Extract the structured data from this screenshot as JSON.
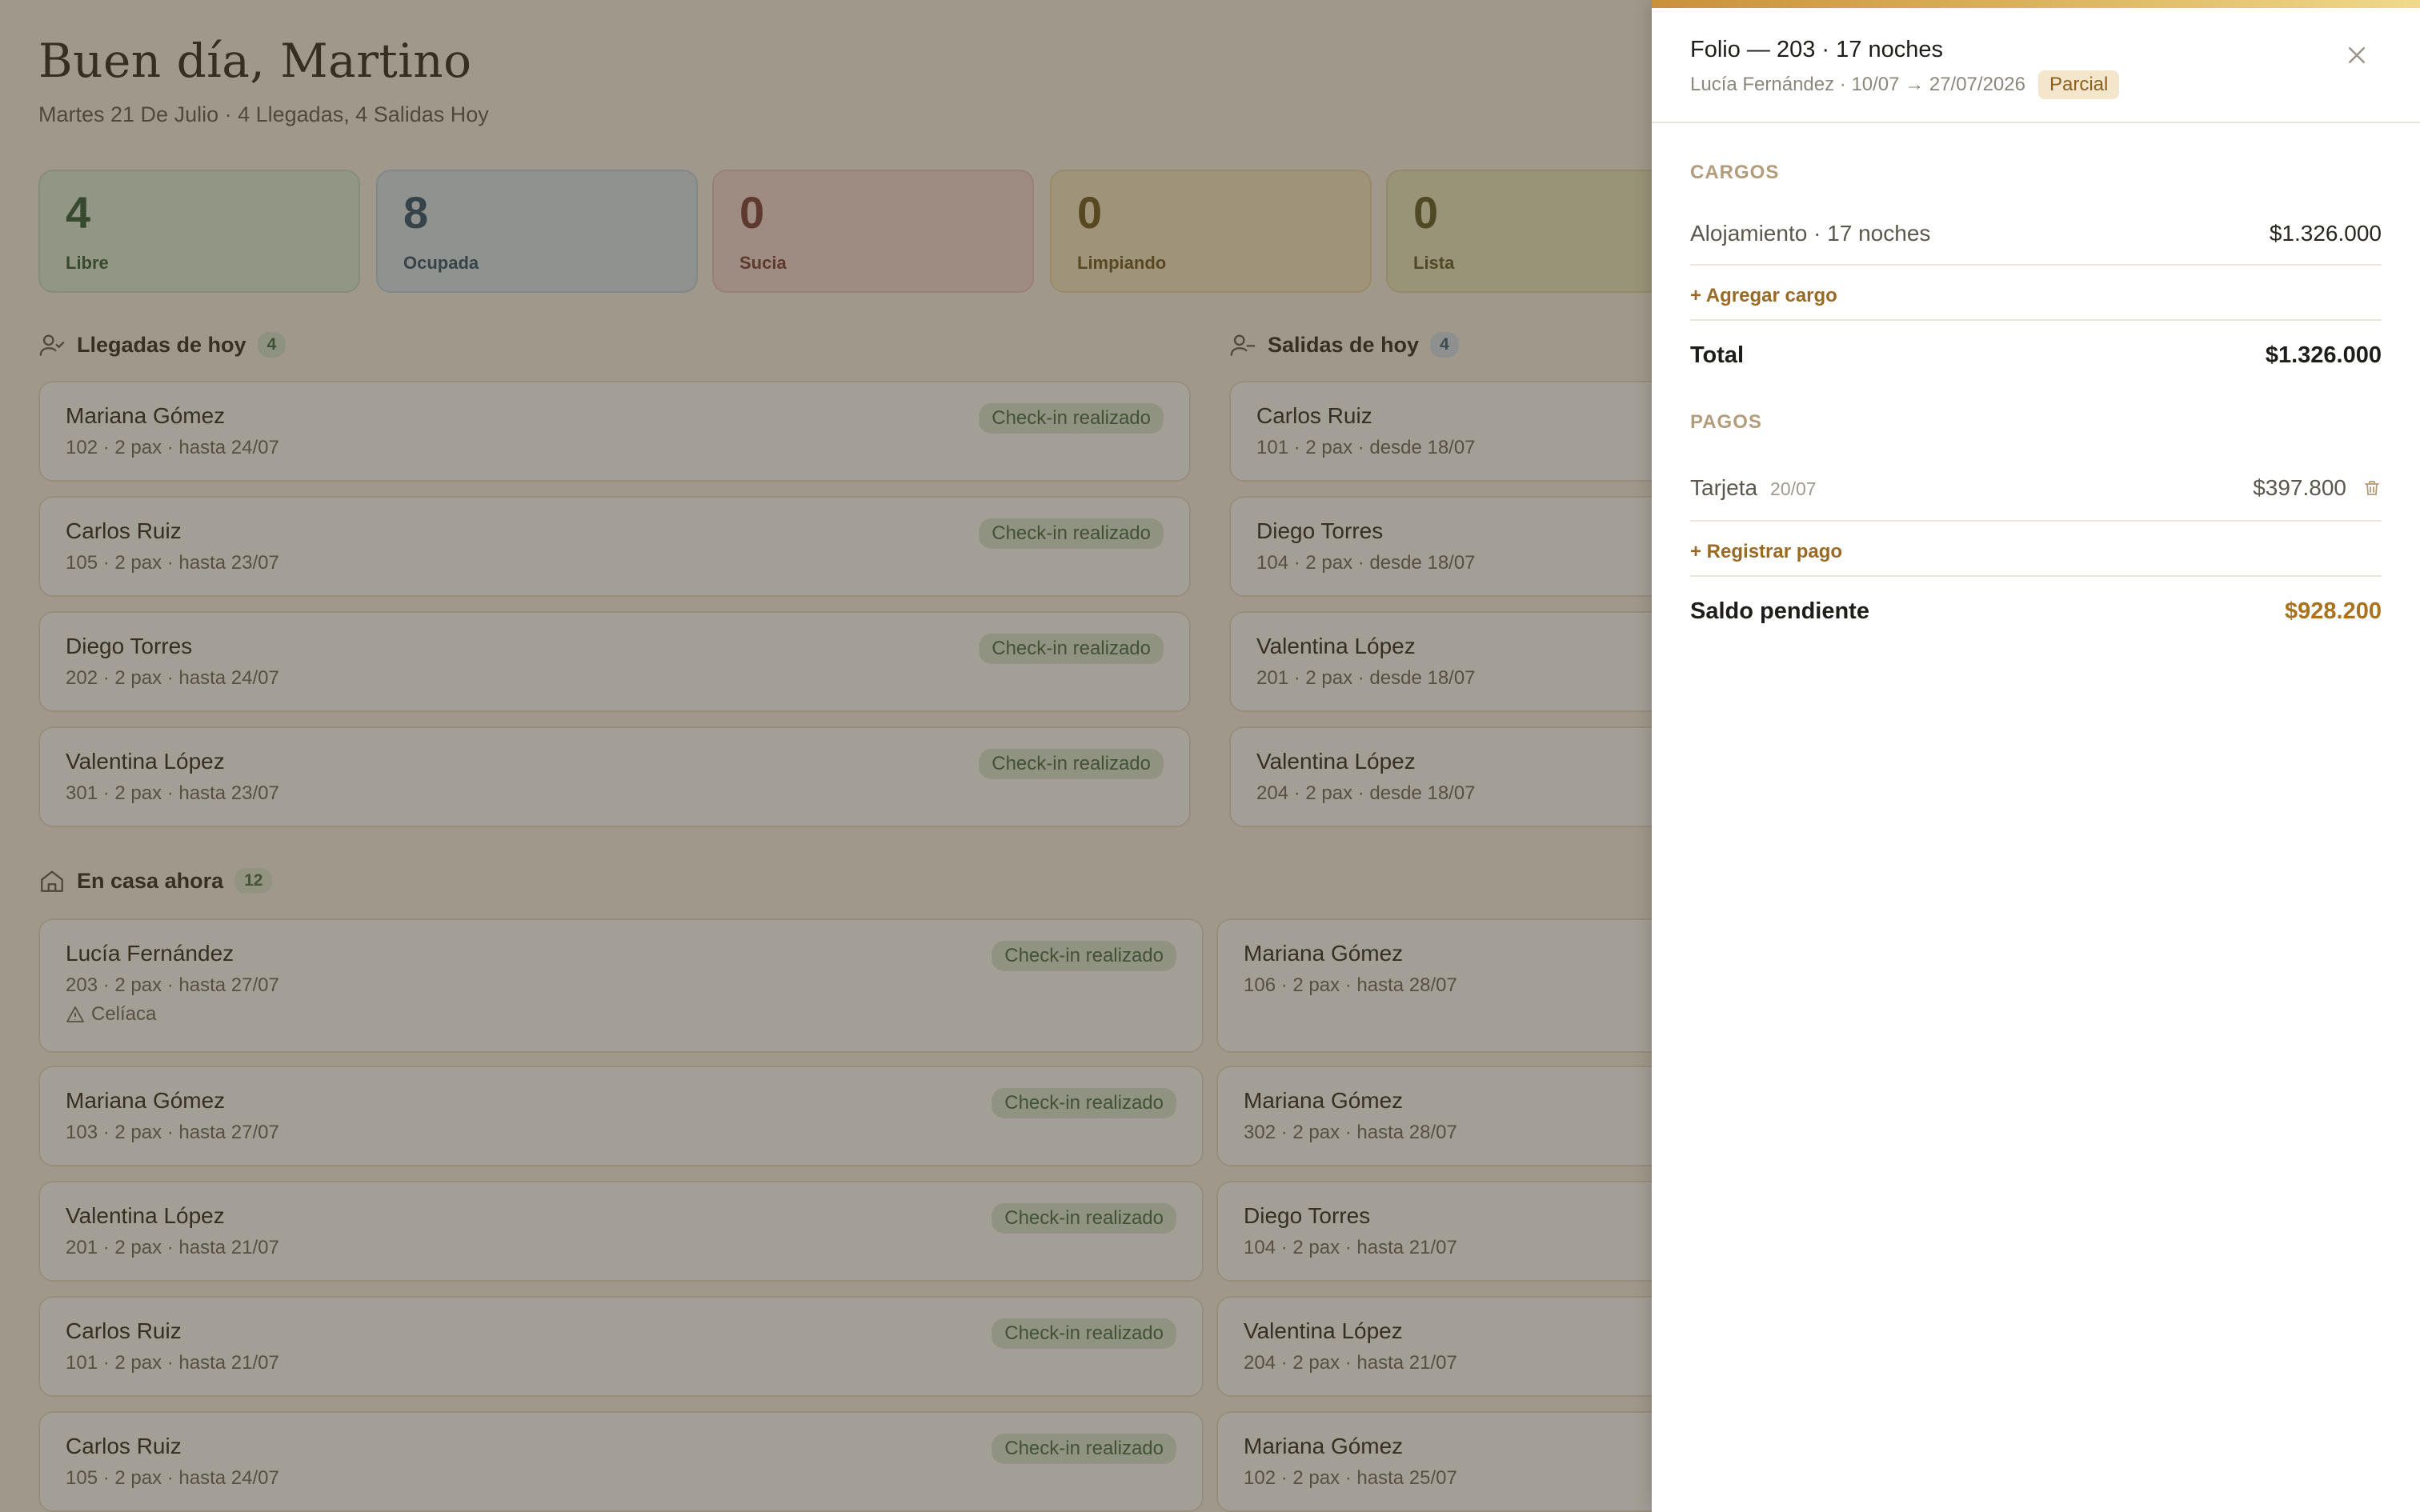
{
  "dashboard": {
    "greeting": "Buen día, Martino",
    "subtitle": "Martes 21 De Julio · 4 Llegadas, 4 Salidas Hoy",
    "stats": [
      {
        "value": "4",
        "label": "Libre"
      },
      {
        "value": "8",
        "label": "Ocupada"
      },
      {
        "value": "0",
        "label": "Sucia"
      },
      {
        "value": "0",
        "label": "Limpiando"
      },
      {
        "value": "0",
        "label": "Lista"
      }
    ],
    "arrivals": {
      "title": "Llegadas de hoy",
      "count": "4",
      "items": [
        {
          "name": "Mariana Gómez",
          "meta": "102 · 2 pax · hasta 24/07",
          "badge": "Check-in realizado"
        },
        {
          "name": "Carlos Ruiz",
          "meta": "105 · 2 pax · hasta 23/07",
          "badge": "Check-in realizado"
        },
        {
          "name": "Diego Torres",
          "meta": "202 · 2 pax · hasta 24/07",
          "badge": "Check-in realizado"
        },
        {
          "name": "Valentina López",
          "meta": "301 · 2 pax · hasta 23/07",
          "badge": "Check-in realizado"
        }
      ]
    },
    "departures": {
      "title": "Salidas de hoy",
      "count": "4",
      "items": [
        {
          "name": "Carlos Ruiz",
          "meta": "101 · 2 pax · desde 18/07"
        },
        {
          "name": "Diego Torres",
          "meta": "104 · 2 pax · desde 18/07"
        },
        {
          "name": "Valentina López",
          "meta": "201 · 2 pax · desde 18/07"
        },
        {
          "name": "Valentina López",
          "meta": "204 · 2 pax · desde 18/07"
        }
      ]
    },
    "inhouse": {
      "title": "En casa ahora",
      "count": "12",
      "left": [
        {
          "name": "Lucía Fernández",
          "meta": "203 · 2 pax · hasta 27/07",
          "alert": "Celíaca",
          "badge": "Check-in realizado"
        },
        {
          "name": "Mariana Gómez",
          "meta": "103 · 2 pax · hasta 27/07",
          "badge": "Check-in realizado"
        },
        {
          "name": "Valentina López",
          "meta": "201 · 2 pax · hasta 21/07",
          "badge": "Check-in realizado"
        },
        {
          "name": "Carlos Ruiz",
          "meta": "101 · 2 pax · hasta 21/07",
          "badge": "Check-in realizado"
        },
        {
          "name": "Carlos Ruiz",
          "meta": "105 · 2 pax · hasta 24/07",
          "badge": "Check-in realizado"
        }
      ],
      "right": [
        {
          "name": "Mariana Gómez",
          "meta": "106 · 2 pax · hasta 28/07"
        },
        {
          "name": "Mariana Gómez",
          "meta": "302 · 2 pax · hasta 28/07"
        },
        {
          "name": "Diego Torres",
          "meta": "104 · 2 pax · hasta 21/07"
        },
        {
          "name": "Valentina López",
          "meta": "204 · 2 pax · hasta 21/07"
        },
        {
          "name": "Mariana Gómez",
          "meta": "102 · 2 pax · hasta 25/07"
        }
      ]
    }
  },
  "folio": {
    "title": "Folio — 203 · 17 noches",
    "subtitle": "Lucía Fernández · 10/07 → 27/07/2026",
    "status": "Parcial",
    "charges_heading": "CARGOS",
    "charges": [
      {
        "label": "Alojamiento · 17 noches",
        "amount": "$1.326.000"
      }
    ],
    "add_charge": "+ Agregar cargo",
    "total_label": "Total",
    "total_amount": "$1.326.000",
    "payments_heading": "PAGOS",
    "payments": [
      {
        "method": "Tarjeta",
        "date": "20/07",
        "amount": "$397.800"
      }
    ],
    "add_payment": "+ Registrar pago",
    "balance_label": "Saldo pendiente",
    "balance_amount": "$928.200"
  },
  "colors": {
    "accent": "#9a6a24",
    "balance": "#a8721f",
    "badge_green": "#dbe9d9"
  }
}
